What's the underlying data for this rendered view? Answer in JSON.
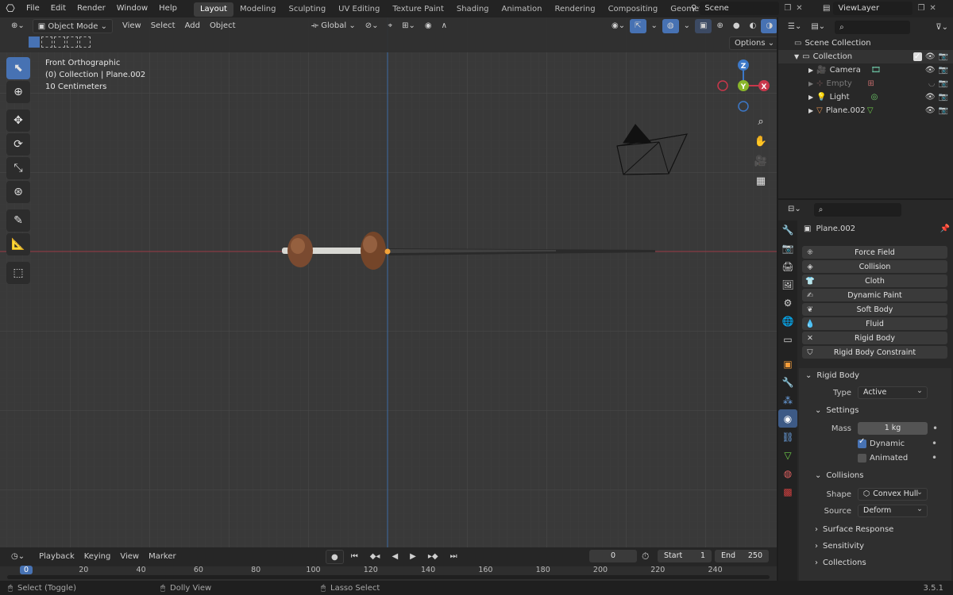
{
  "topbar": {
    "menus": [
      "File",
      "Edit",
      "Render",
      "Window",
      "Help"
    ],
    "workspaces": [
      "Layout",
      "Modeling",
      "Sculpting",
      "UV Editing",
      "Texture Paint",
      "Shading",
      "Animation",
      "Rendering",
      "Compositing",
      "Geometry Nodes"
    ],
    "active_workspace": "Layout",
    "scene": "Scene",
    "view_layer": "ViewLayer"
  },
  "viewport_header": {
    "mode": "Object Mode",
    "menus": [
      "View",
      "Select",
      "Add",
      "Object"
    ],
    "orientation": "Global",
    "options": "Options"
  },
  "viewport_info": {
    "view_name": "Front Orthographic",
    "collection_line": "(0) Collection | Plane.002",
    "scale": "10 Centimeters"
  },
  "gizmo": {
    "z": "Z",
    "y": "Y",
    "x": "X"
  },
  "outliner": {
    "root": "Scene Collection",
    "collection": "Collection",
    "items": [
      {
        "name": "Camera",
        "icon": "camera-icon",
        "dimmed": false
      },
      {
        "name": "Empty",
        "icon": "empty-icon",
        "dimmed": true
      },
      {
        "name": "Light",
        "icon": "light-icon",
        "dimmed": false
      },
      {
        "name": "Plane.002",
        "icon": "mesh-icon",
        "dimmed": false
      }
    ]
  },
  "properties": {
    "object_name": "Plane.002",
    "physics_buttons": [
      {
        "label": "Force Field",
        "icon": "force-field-icon"
      },
      {
        "label": "Collision",
        "icon": "collision-icon"
      },
      {
        "label": "Cloth",
        "icon": "cloth-icon"
      },
      {
        "label": "Dynamic Paint",
        "icon": "dynamic-paint-icon"
      },
      {
        "label": "Soft Body",
        "icon": "soft-body-icon"
      },
      {
        "label": "Fluid",
        "icon": "fluid-icon"
      },
      {
        "label": "Rigid Body",
        "icon": "remove-icon"
      },
      {
        "label": "Rigid Body Constraint",
        "icon": "constraint-icon"
      }
    ],
    "rigid_body": {
      "title": "Rigid Body",
      "type_label": "Type",
      "type_value": "Active",
      "settings_title": "Settings",
      "mass_label": "Mass",
      "mass_value": "1 kg",
      "dynamic_label": "Dynamic",
      "dynamic_checked": true,
      "animated_label": "Animated",
      "animated_checked": false,
      "collisions_title": "Collisions",
      "shape_label": "Shape",
      "shape_value": "Convex Hull",
      "source_label": "Source",
      "source_value": "Deform",
      "surface_response": "Surface Response",
      "sensitivity": "Sensitivity",
      "collections": "Collections"
    }
  },
  "timeline": {
    "menus": [
      "Playback",
      "Keying",
      "View",
      "Marker"
    ],
    "current_frame": "0",
    "start_label": "Start",
    "start_value": "1",
    "end_label": "End",
    "end_value": "250",
    "ruler_marks": [
      "0",
      "20",
      "40",
      "60",
      "80",
      "100",
      "120",
      "140",
      "160",
      "180",
      "200",
      "220",
      "240"
    ]
  },
  "statusbar": {
    "hint1": "Select (Toggle)",
    "hint2": "Dolly View",
    "hint3": "Lasso Select",
    "version": "3.5.1"
  },
  "colors": {
    "accent": "#4772b3",
    "x_axis": "#c8374b",
    "y_axis": "#8ab62a",
    "z_axis": "#3c78c8",
    "viewport_bg": "#393939"
  }
}
